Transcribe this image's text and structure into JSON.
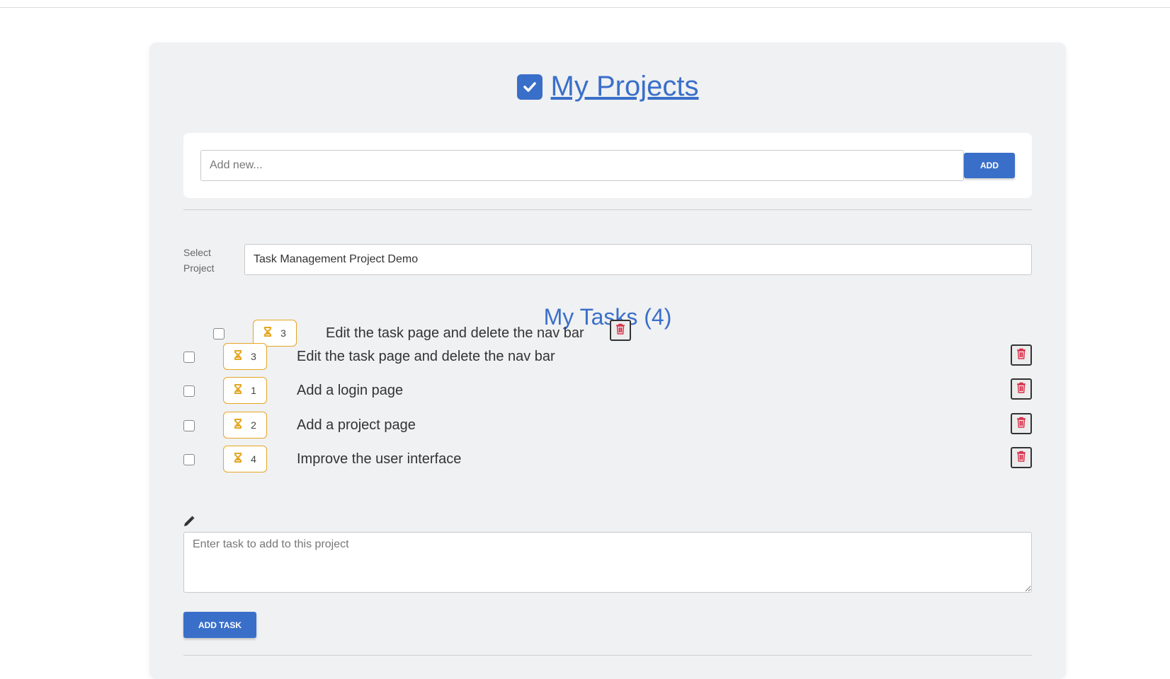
{
  "header": {
    "title": "My Projects",
    "icon": "checkbox-icon"
  },
  "add_project": {
    "placeholder": "Add new...",
    "button_label": "ADD"
  },
  "project_selector": {
    "label": "Select Project",
    "selected": "Task Management Project Demo"
  },
  "tasks": {
    "heading": "My Tasks (4)",
    "dragging_item": {
      "priority": "3",
      "text": "Edit the task page and delete the nav bar"
    },
    "items": [
      {
        "priority": "3",
        "text": "Edit the task page and delete the nav bar"
      },
      {
        "priority": "1",
        "text": "Add a login page"
      },
      {
        "priority": "2",
        "text": "Add a project page"
      },
      {
        "priority": "4",
        "text": "Improve the user interface"
      }
    ]
  },
  "new_task": {
    "placeholder": "Enter task to add to this project",
    "button_label": "ADD TASK",
    "icon": "pencil-icon"
  },
  "colors": {
    "primary": "#3a6fc9",
    "badge_border": "#e5a623",
    "delete_icon": "#d9304a",
    "card_bg": "#f0f1f3"
  }
}
